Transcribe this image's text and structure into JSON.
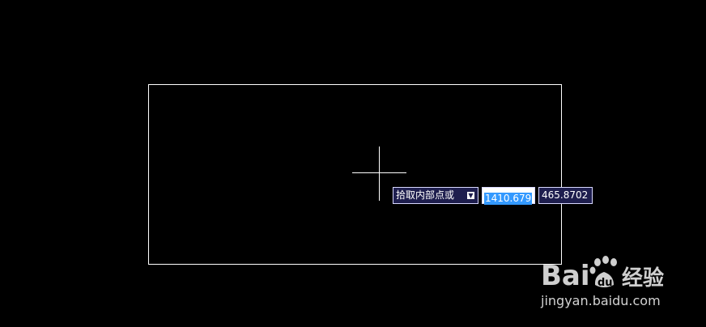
{
  "dynamic_input": {
    "prompt_label": "拾取内部点或",
    "prompt_arrow_icon": "down-arrow-icon",
    "x_value": "1410.679",
    "y_value": "465.8702"
  },
  "watermark": {
    "site": "jingyan.baidu.com"
  },
  "colors": {
    "background": "#000000",
    "lines": "#ffffff",
    "tooltip_bg": "#1e1e4e",
    "selection": "#3399ff"
  }
}
